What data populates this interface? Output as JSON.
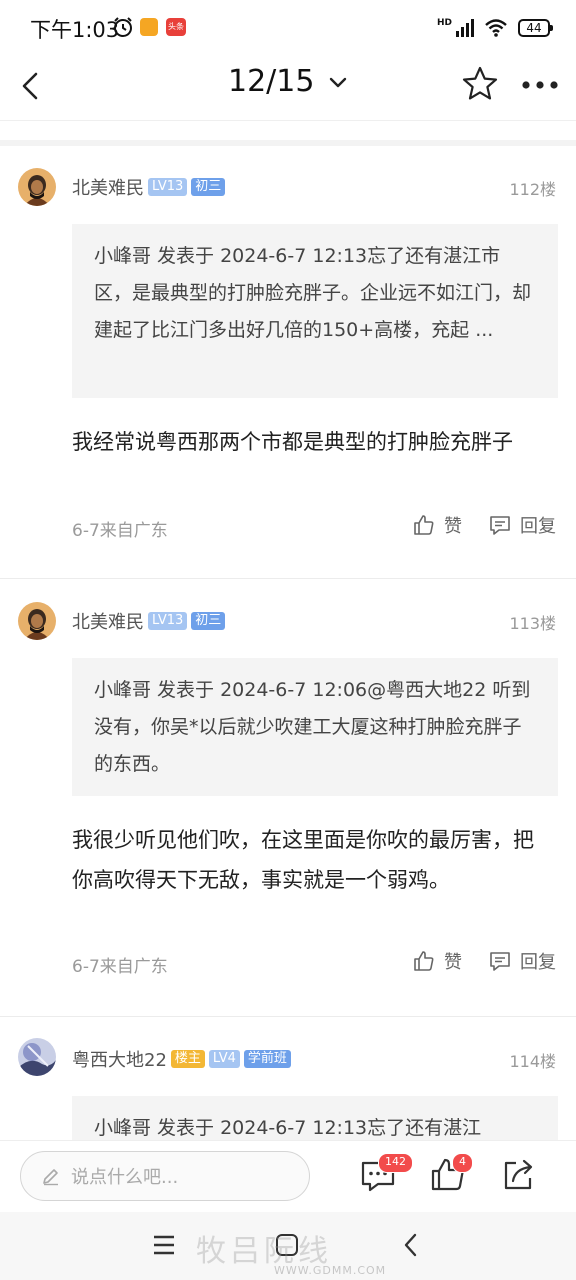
{
  "status_bar": {
    "time": "下午1:03",
    "network": "HD",
    "battery": "44",
    "app_badge": "头条"
  },
  "nav": {
    "page_indicator": "12/15"
  },
  "posts": [
    {
      "username": "北美难民",
      "level": "LV13",
      "rank": "初三",
      "floor": "112楼",
      "quote": "小峰哥 发表于 2024-6-7 12:13忘了还有湛江市区，是最典型的打肿脸充胖子。企业远不如江门，却建起了比江门多出好几倍的150+高楼，充起 ...",
      "content": "我经常说粤西那两个市都是典型的打肿脸充胖子",
      "meta": "6-7来自广东",
      "like_label": "赞",
      "reply_label": "回复"
    },
    {
      "username": "北美难民",
      "level": "LV13",
      "rank": "初三",
      "floor": "113楼",
      "quote": "小峰哥 发表于 2024-6-7 12:06@粤西大地22 听到没有，你吴*以后就少吹建工大厦这种打肿脸充胖子的东西。",
      "content": "我很少听见他们吹，在这里面是你吹的最厉害，把你高吹得天下无敌，事实就是一个弱鸡。",
      "meta": "6-7来自广东",
      "like_label": "赞",
      "reply_label": "回复"
    },
    {
      "username": "粤西大地22",
      "host": "楼主",
      "level": "LV4",
      "rank": "学前班",
      "floor": "114楼",
      "quote": "小峰哥 发表于 2024-6-7 12:13忘了还有湛江"
    }
  ],
  "bottom_bar": {
    "comment_placeholder": "说点什么吧...",
    "comment_count": "142",
    "like_count": "4"
  },
  "watermark": {
    "main": "牧吕阮线",
    "sub": "WWW.GDMM.COM"
  }
}
